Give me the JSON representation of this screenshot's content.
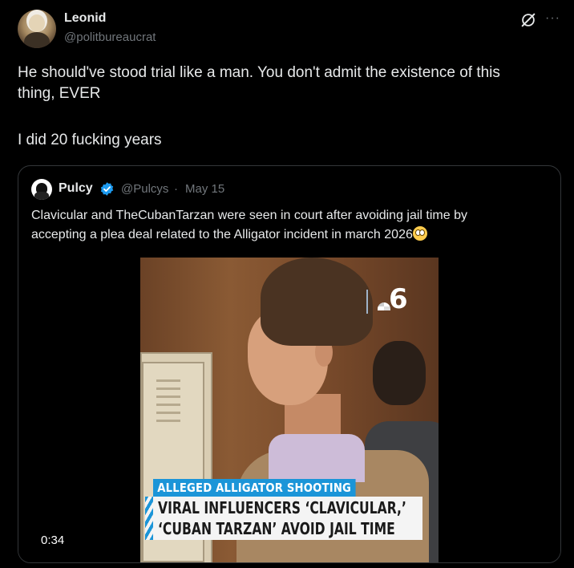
{
  "post": {
    "author": {
      "name": "Leonid",
      "handle": "@politbureaucrat"
    },
    "text_line1": "He should've stood trial like a man. You don't admit the existence of this",
    "text_line2": "thing, EVER",
    "text_line3": "I did 20 fucking years",
    "actions": {
      "grok_icon": "grok-icon",
      "more_icon": "more-icon",
      "more_glyph": "···"
    }
  },
  "quote": {
    "author": {
      "name": "Pulcy",
      "handle": "@Pulcys",
      "verified": true,
      "date_separator": "·",
      "date": "May 15"
    },
    "text_line1": "Clavicular and TheCubanTarzan were seen in court after avoiding jail time by",
    "text_line2": "accepting a plea deal related to the Alligator incident in march 2026",
    "emoji": "flushed-face-icon",
    "video": {
      "duration": "0:34",
      "logo_number": "6",
      "ticker_top": "ALLEGED ALLIGATOR SHOOTING",
      "ticker_line1": "VIRAL INFLUENCERS ‘CLAVICULAR,’",
      "ticker_line2": "‘CUBAN TARZAN’ AVOID JAIL TIME"
    }
  },
  "colors": {
    "background": "#000000",
    "text_primary": "#e7e9ea",
    "text_secondary": "#71767b",
    "border": "#333639",
    "verified": "#1d9bf0",
    "ticker_blue": "#1b95d8"
  }
}
